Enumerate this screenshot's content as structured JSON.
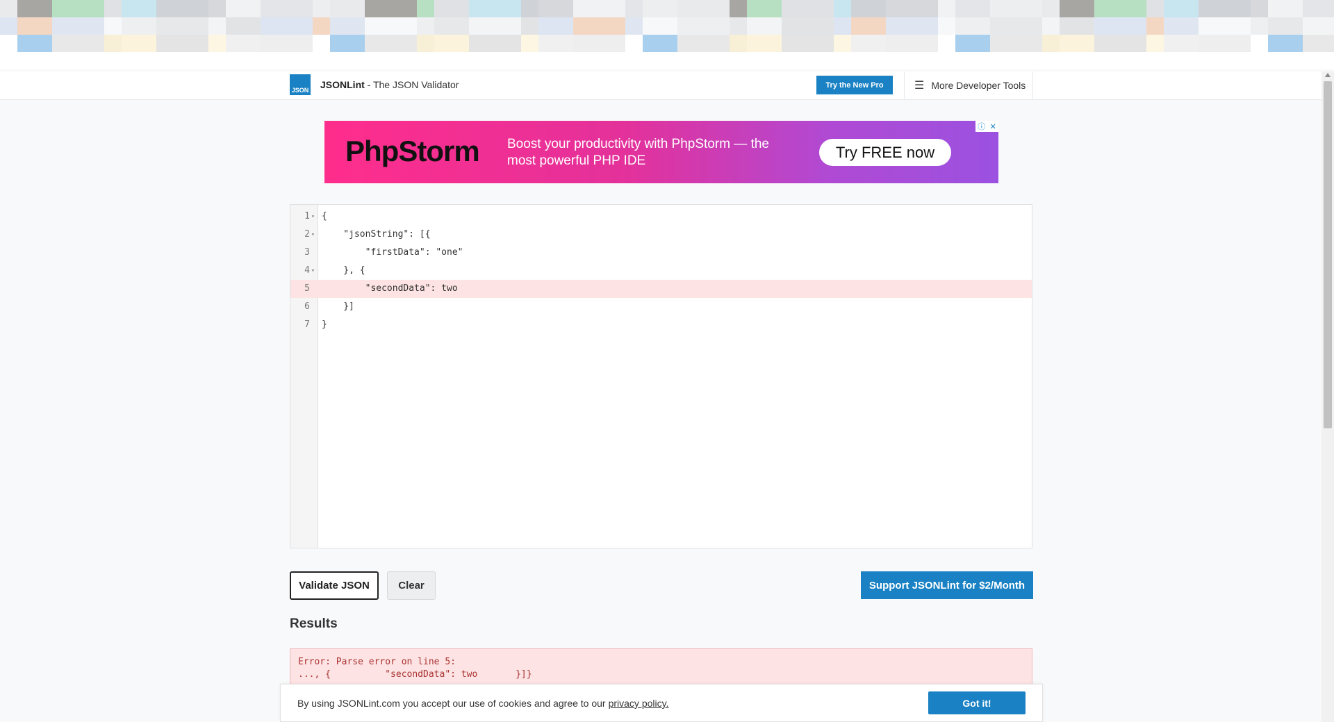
{
  "header": {
    "logo_text": "JSON",
    "site_name": "JSONLint",
    "site_tagline": " - The JSON Validator",
    "pro_button": "Try the New Pro",
    "more_tools": "More Developer Tools"
  },
  "ad": {
    "brand": "PhpStorm",
    "headline": "Boost your productivity with PhpStorm — the most powerful PHP IDE",
    "cta": "Try FREE now",
    "info_icon": "ⓘ",
    "close_icon": "✕"
  },
  "editor": {
    "lines": [
      {
        "num": "1",
        "fold": "▾",
        "code": "{"
      },
      {
        "num": "2",
        "fold": "▾",
        "code": "    \"jsonString\": [{"
      },
      {
        "num": "3",
        "fold": "",
        "code": "        \"firstData\": \"one\""
      },
      {
        "num": "4",
        "fold": "▾",
        "code": "    }, {"
      },
      {
        "num": "5",
        "fold": "",
        "code": "        \"secondData\": two"
      },
      {
        "num": "6",
        "fold": "",
        "code": "    }]"
      },
      {
        "num": "7",
        "fold": "",
        "code": "}"
      }
    ],
    "error_line": 5
  },
  "buttons": {
    "validate": "Validate JSON",
    "clear": "Clear",
    "support": "Support JSONLint for $2/Month"
  },
  "results": {
    "title": "Results",
    "error_text": "Error: Parse error on line 5:\n..., {          \"secondData\": two       }]}"
  },
  "cookie": {
    "text": "By using JSONLint.com you accept our use of cookies and agree to our",
    "privacy_link": "privacy policy.",
    "button": "Got it!"
  },
  "colors": {
    "accent": "#1a82c4",
    "error_bg": "#fde3e3",
    "error_text": "#a33333"
  }
}
